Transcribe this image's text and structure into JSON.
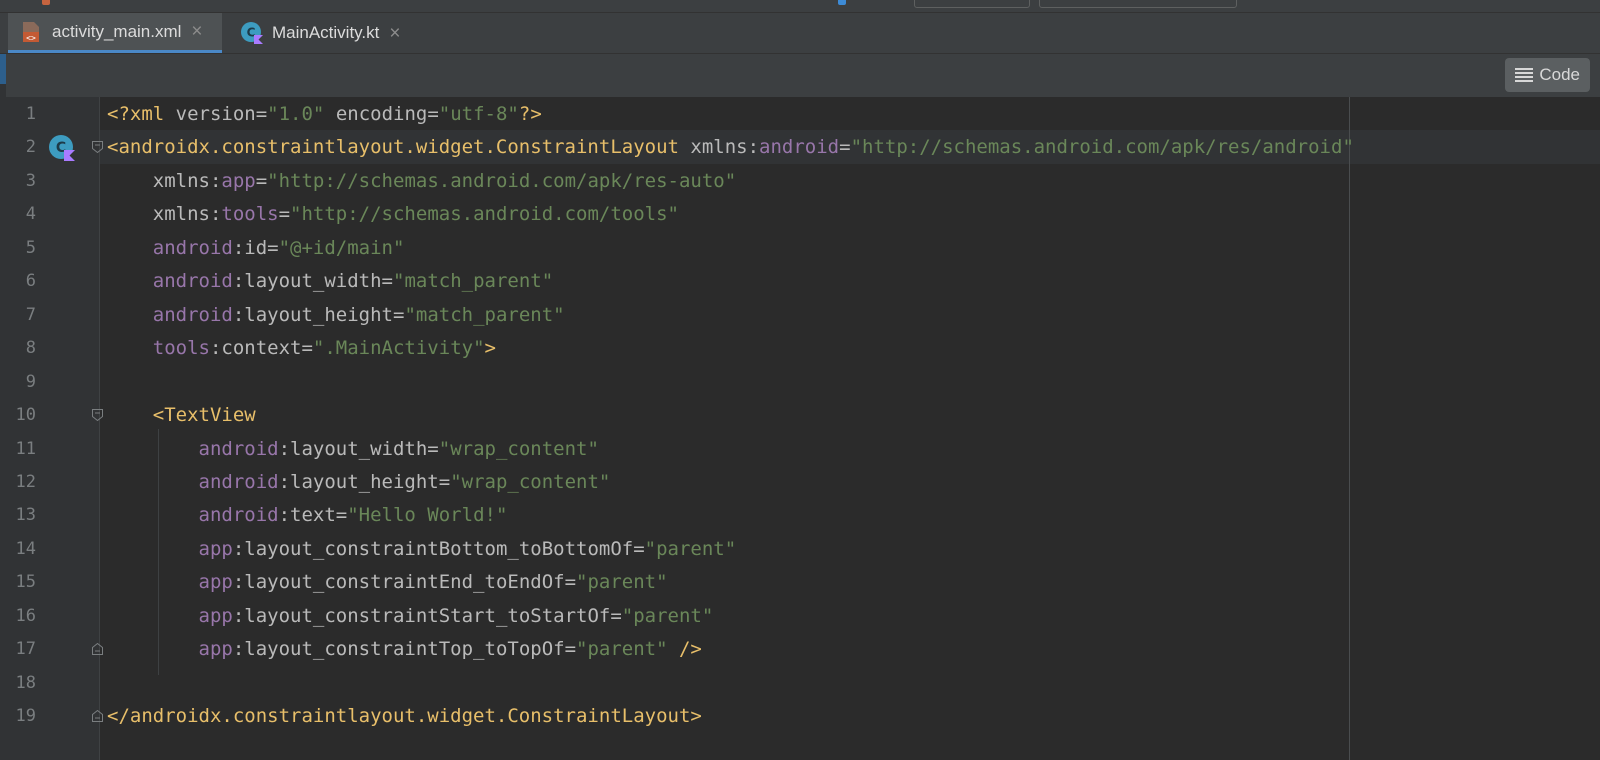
{
  "tabs": [
    {
      "label": "activity_main.xml",
      "active": true,
      "icon": "xml-file-icon"
    },
    {
      "label": "MainActivity.kt",
      "active": false,
      "icon": "kotlin-class-icon"
    }
  ],
  "toolbar": {
    "code_label": "Code",
    "code_icon": "hamburger-lines-icon"
  },
  "editor": {
    "line_numbers": [
      "1",
      "2",
      "3",
      "4",
      "5",
      "6",
      "7",
      "8",
      "9",
      "10",
      "11",
      "12",
      "13",
      "14",
      "15",
      "16",
      "17",
      "18",
      "19"
    ],
    "lines": [
      {
        "tokens": [
          {
            "t": "<?xml ",
            "c": "c-tag"
          },
          {
            "t": "version",
            "c": "c-attr"
          },
          {
            "t": "=",
            "c": "c-attr"
          },
          {
            "t": "\"1.0\"",
            "c": "c-val"
          },
          {
            "t": " ",
            "c": "c-attr"
          },
          {
            "t": "encoding",
            "c": "c-attr"
          },
          {
            "t": "=",
            "c": "c-attr"
          },
          {
            "t": "\"utf-8\"",
            "c": "c-val"
          },
          {
            "t": "?>",
            "c": "c-tag"
          }
        ]
      },
      {
        "tokens": [
          {
            "t": "<androidx.constraintlayout.widget.ConstraintLayout",
            "c": "c-tag"
          },
          {
            "t": " xmlns:",
            "c": "c-attr"
          },
          {
            "t": "android",
            "c": "c-ns"
          },
          {
            "t": "=",
            "c": "c-attr"
          },
          {
            "t": "\"http://schemas.android.com/apk/res/android\"",
            "c": "c-val"
          }
        ]
      },
      {
        "tokens": [
          {
            "t": "    xmlns:",
            "c": "c-attr"
          },
          {
            "t": "app",
            "c": "c-ns"
          },
          {
            "t": "=",
            "c": "c-attr"
          },
          {
            "t": "\"http://schemas.android.com/apk/res-auto\"",
            "c": "c-val"
          }
        ]
      },
      {
        "tokens": [
          {
            "t": "    xmlns:",
            "c": "c-attr"
          },
          {
            "t": "tools",
            "c": "c-ns"
          },
          {
            "t": "=",
            "c": "c-attr"
          },
          {
            "t": "\"http://schemas.android.com/tools\"",
            "c": "c-val"
          }
        ]
      },
      {
        "tokens": [
          {
            "t": "    ",
            "c": "c-attr"
          },
          {
            "t": "android",
            "c": "c-ns"
          },
          {
            "t": ":id=",
            "c": "c-attr"
          },
          {
            "t": "\"@+id/main\"",
            "c": "c-val"
          }
        ]
      },
      {
        "tokens": [
          {
            "t": "    ",
            "c": "c-attr"
          },
          {
            "t": "android",
            "c": "c-ns"
          },
          {
            "t": ":layout_width=",
            "c": "c-attr"
          },
          {
            "t": "\"match_parent\"",
            "c": "c-val"
          }
        ]
      },
      {
        "tokens": [
          {
            "t": "    ",
            "c": "c-attr"
          },
          {
            "t": "android",
            "c": "c-ns"
          },
          {
            "t": ":layout_height=",
            "c": "c-attr"
          },
          {
            "t": "\"match_parent\"",
            "c": "c-val"
          }
        ]
      },
      {
        "tokens": [
          {
            "t": "    ",
            "c": "c-attr"
          },
          {
            "t": "tools",
            "c": "c-ns"
          },
          {
            "t": ":context=",
            "c": "c-attr"
          },
          {
            "t": "\".MainActivity\"",
            "c": "c-val"
          },
          {
            "t": ">",
            "c": "c-tag"
          }
        ]
      },
      {
        "tokens": []
      },
      {
        "tokens": [
          {
            "t": "    <TextView",
            "c": "c-tag"
          }
        ]
      },
      {
        "tokens": [
          {
            "t": "        ",
            "c": "c-attr"
          },
          {
            "t": "android",
            "c": "c-ns"
          },
          {
            "t": ":layout_width=",
            "c": "c-attr"
          },
          {
            "t": "\"wrap_content\"",
            "c": "c-val"
          }
        ]
      },
      {
        "tokens": [
          {
            "t": "        ",
            "c": "c-attr"
          },
          {
            "t": "android",
            "c": "c-ns"
          },
          {
            "t": ":layout_height=",
            "c": "c-attr"
          },
          {
            "t": "\"wrap_content\"",
            "c": "c-val"
          }
        ]
      },
      {
        "tokens": [
          {
            "t": "        ",
            "c": "c-attr"
          },
          {
            "t": "android",
            "c": "c-ns"
          },
          {
            "t": ":text=",
            "c": "c-attr"
          },
          {
            "t": "\"Hello World!\"",
            "c": "c-val"
          }
        ]
      },
      {
        "tokens": [
          {
            "t": "        ",
            "c": "c-attr"
          },
          {
            "t": "app",
            "c": "c-ns"
          },
          {
            "t": ":layout_constraintBottom_toBottomOf=",
            "c": "c-attr"
          },
          {
            "t": "\"parent\"",
            "c": "c-val"
          }
        ]
      },
      {
        "tokens": [
          {
            "t": "        ",
            "c": "c-attr"
          },
          {
            "t": "app",
            "c": "c-ns"
          },
          {
            "t": ":layout_constraintEnd_toEndOf=",
            "c": "c-attr"
          },
          {
            "t": "\"parent\"",
            "c": "c-val"
          }
        ]
      },
      {
        "tokens": [
          {
            "t": "        ",
            "c": "c-attr"
          },
          {
            "t": "app",
            "c": "c-ns"
          },
          {
            "t": ":layout_constraintStart_toStartOf=",
            "c": "c-attr"
          },
          {
            "t": "\"parent\"",
            "c": "c-val"
          }
        ]
      },
      {
        "tokens": [
          {
            "t": "        ",
            "c": "c-attr"
          },
          {
            "t": "app",
            "c": "c-ns"
          },
          {
            "t": ":layout_constraintTop_toTopOf=",
            "c": "c-attr"
          },
          {
            "t": "\"parent\"",
            "c": "c-val"
          },
          {
            "t": " />",
            "c": "c-tag"
          }
        ]
      },
      {
        "tokens": []
      },
      {
        "tokens": [
          {
            "t": "</androidx.constraintlayout.widget.ConstraintLayout>",
            "c": "c-tag"
          }
        ]
      }
    ],
    "gutter_icon": "kotlin-class-icon",
    "fold_icon": "fold-marker-icon"
  },
  "colors": {
    "background": "#2b2b2b",
    "tag": "#e8bf6a",
    "attribute": "#bababa",
    "namespace": "#9876aa",
    "string": "#6a8759",
    "line_number": "#7a7e80",
    "active_tab_underline": "#4a88c7"
  }
}
